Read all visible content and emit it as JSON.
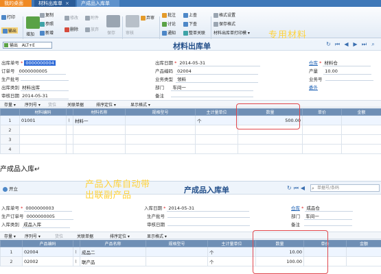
{
  "tabs": [
    {
      "label": "我的桌面",
      "close": ""
    },
    {
      "label": "材料出库单",
      "close": "×"
    },
    {
      "label": "产成品入库单",
      "close": "×"
    }
  ],
  "ribbon": {
    "print": "打印",
    "output": "输出",
    "add": "增加",
    "copy": "复制",
    "reference": "参照",
    "new": "新增",
    "modify": "修改",
    "delete": "删除",
    "abandon": "放弃",
    "attachment": "附件",
    "save": "保存",
    "audit": "审核",
    "abandon_audit": "弃审",
    "approval": "批注",
    "discuss": "讨论",
    "notify": "通知",
    "up": "上查",
    "down": "下查",
    "whole_link": "整单关联",
    "format_settings": "格式设置",
    "save_format": "保存格式",
    "print_template": "材料出库单打印模 ▾",
    "brand_annotation": "专用材料"
  },
  "form1": {
    "output_checkbox": "输出",
    "shortcut": "ALT+E",
    "title": "材料出库单",
    "fields": {
      "doc_no_label": "出库单号",
      "doc_no": "0000000004",
      "order_no_label": "订单号",
      "order_no": "0000000005",
      "batch_label": "生产批号",
      "batch": "",
      "category_label": "出库类别",
      "category": "材料出库",
      "auditdate_label": "审核日期",
      "auditdate": "2014-05-31",
      "date_label": "出库日期",
      "date": "2014-05-31",
      "product_code_label": "产品编码",
      "product_code": "02004",
      "biz_type_label": "业务类型",
      "biz_type": "领料",
      "dept_label": "部门",
      "dept": "车间一",
      "remark_label": "备注",
      "remark": "",
      "warehouse_label": "仓库",
      "warehouse": "材料仓",
      "qty_label": "产量",
      "qty": "10.00",
      "biz_no_label": "业务号",
      "biz_no": "",
      "supervisor_label": "委外",
      "supervisor": "委托外"
    },
    "gridbar": [
      "存量 ▾",
      "序列号 ▾",
      "货位",
      "关联单据",
      "排序定位 ▾",
      "显示格式 ▾"
    ],
    "columns": [
      "",
      "材料编码",
      "",
      "材料名称",
      "规格型号",
      "主计量单位",
      "数量",
      "单价",
      "金额"
    ],
    "rows": [
      {
        "n": "1",
        "code": "01001",
        "name": "材料一",
        "spec": "",
        "unit": "个",
        "qty": "500.00",
        "price": "",
        "amount": ""
      },
      {
        "n": "2",
        "code": "",
        "name": "",
        "spec": "",
        "unit": "",
        "qty": "",
        "price": "",
        "amount": ""
      },
      {
        "n": "3",
        "code": "",
        "name": "",
        "spec": "",
        "unit": "",
        "qty": "",
        "price": "",
        "amount": ""
      },
      {
        "n": "4",
        "code": "",
        "name": "",
        "spec": "",
        "unit": "",
        "qty": "",
        "price": "",
        "amount": ""
      }
    ]
  },
  "caption": "产成品入库↵",
  "form2": {
    "open_label": "开立",
    "title": "产成品入库单",
    "annotation_line1": "产品入库自动带",
    "annotation_line2": "出联副产品",
    "search_placeholder": "单据号/条码",
    "fields": {
      "doc_no_label": "入库单号",
      "doc_no": "0000000003",
      "order_no_label": "生产订单号",
      "order_no": "0000000005",
      "category_label": "入库类别",
      "category": "成品入库",
      "date_label": "入库日期",
      "date": "2014-05-31",
      "batch_label": "生产批号",
      "batch": "",
      "auditdate_label": "审核日期",
      "auditdate": "",
      "warehouse_label": "仓库",
      "warehouse": "成品仓",
      "dept_label": "部门",
      "dept": "车间一",
      "remark_label": "备注",
      "remark": ""
    },
    "gridbar": [
      "存量 ▾",
      "序列号 ▾",
      "货位",
      "关联单据",
      "排序定位 ▾",
      "显示格式 ▾"
    ],
    "columns": [
      "",
      "产品编码",
      "",
      "产品名称",
      "规格型号",
      "主计量单位",
      "数量",
      "单价",
      "金额"
    ],
    "rows": [
      {
        "n": "1",
        "code": "02004",
        "name": "成品二",
        "spec": "",
        "unit": "个",
        "qty": "10.00"
      },
      {
        "n": "2",
        "code": "02002",
        "name": "联产品",
        "spec": "",
        "unit": "个",
        "qty": "100.00"
      }
    ]
  }
}
